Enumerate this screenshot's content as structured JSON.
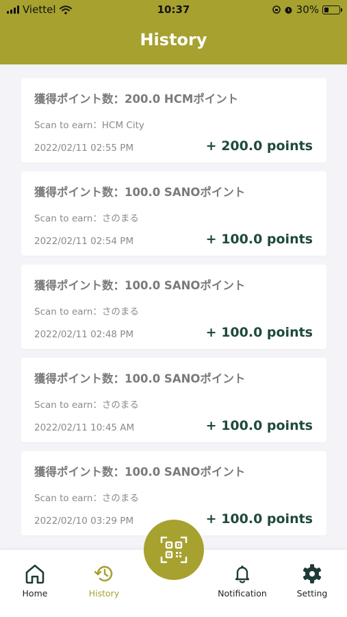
{
  "status_bar": {
    "carrier": "Viettel",
    "time": "10:37",
    "battery": "30%"
  },
  "header": {
    "title": "History",
    "bg_color": "#a7a12f"
  },
  "history": [
    {
      "title": "獲得ポイント数：200.0 HCMポイント",
      "scan_label": "Scan to earn",
      "location": "HCM City",
      "date": "2022/02/11 02:55 PM",
      "points": "+ 200.0 points"
    },
    {
      "title": "獲得ポイント数：100.0 SANOポイント",
      "scan_label": "Scan to earn",
      "location": "さのまる",
      "date": "2022/02/11 02:54 PM",
      "points": "+ 100.0 points"
    },
    {
      "title": "獲得ポイント数：100.0 SANOポイント",
      "scan_label": "Scan to earn",
      "location": "さのまる",
      "date": "2022/02/11 02:48 PM",
      "points": "+ 100.0 points"
    },
    {
      "title": "獲得ポイント数：100.0 SANOポイント",
      "scan_label": "Scan to earn",
      "location": "さのまる",
      "date": "2022/02/11 10:45 AM",
      "points": "+ 100.0 points"
    },
    {
      "title": "獲得ポイント数：100.0 SANOポイント",
      "scan_label": "Scan to earn",
      "location": "さのまる",
      "date": "2022/02/10 03:29 PM",
      "points": "+ 100.0 points"
    }
  ],
  "tabbar": {
    "home": "Home",
    "history": "History",
    "notification": "Notification",
    "setting": "Setting",
    "active": "history",
    "accent_color": "#a7a12f"
  }
}
